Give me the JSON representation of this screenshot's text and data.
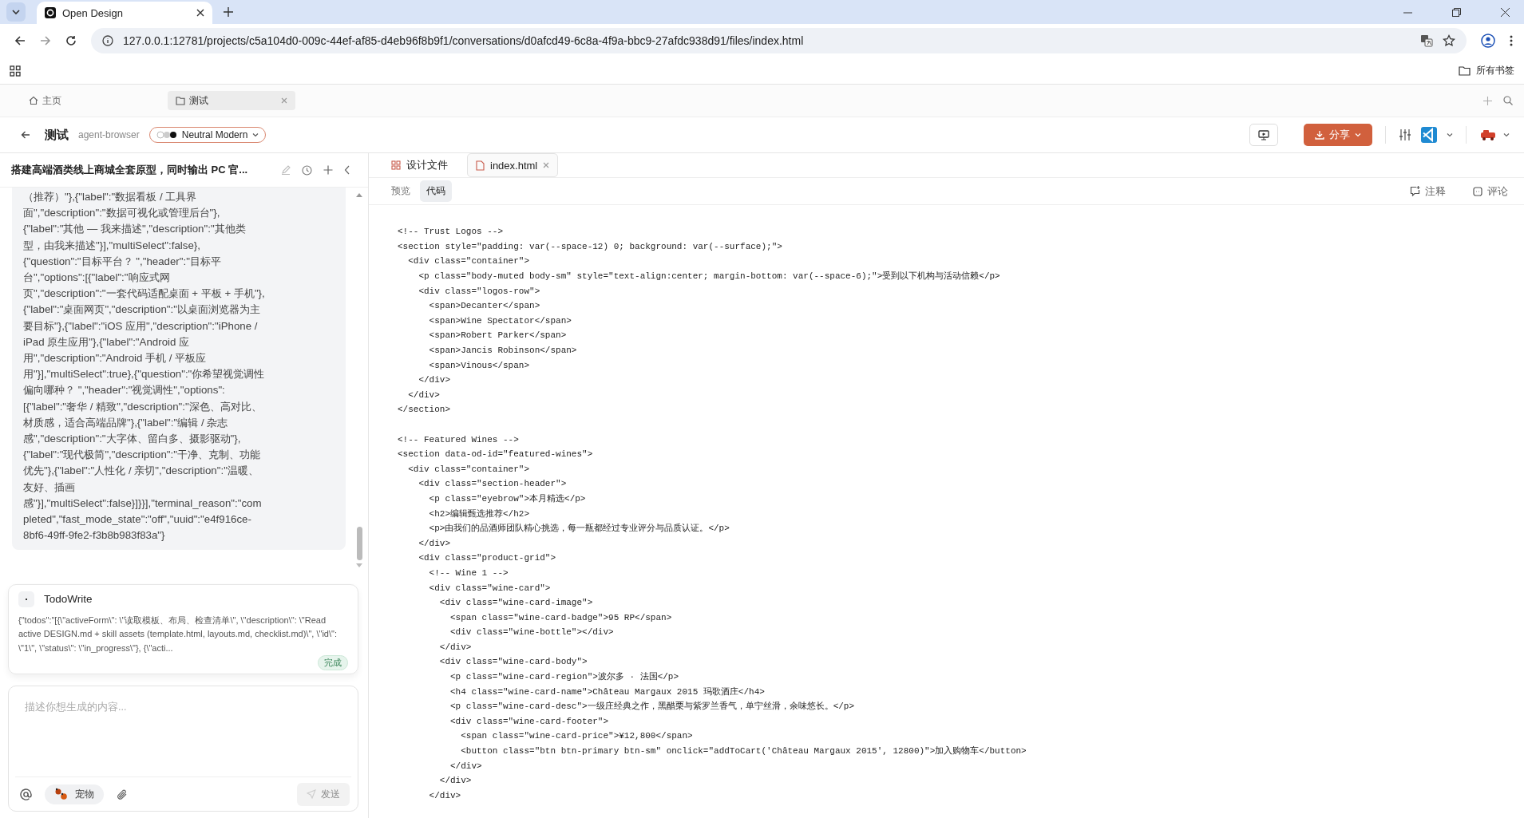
{
  "browser": {
    "tabs": [
      {
        "title": "Open Design",
        "selected": true
      }
    ],
    "url": "127.0.0.1:12781/projects/c5a104d0-009c-44ef-af85-d4eb96f8b9f1/conversations/d0afcd49-6c8a-4f9a-bbc9-27afdc938d91/files/index.html",
    "bookmarks_folder": "所有书签"
  },
  "app_tabs": [
    {
      "label": "主页",
      "kind": "home",
      "selected": false
    },
    {
      "label": "测试",
      "kind": "folder",
      "selected": true
    }
  ],
  "header": {
    "title": "测试",
    "agent": "agent-browser",
    "theme": "Neutral Modern",
    "share_label": "分享"
  },
  "chat": {
    "title": "搭建高端酒类线上商城全套原型，同时输出 PC 官...",
    "message_lines": [
      "（推荐）\"},{\"label\":\"数据看板 / 工具界",
      "面\",\"description\":\"数据可视化或管理后台\"},",
      "{\"label\":\"其他 — 我来描述\",\"description\":\"其他类",
      "型，由我来描述\"}],\"multiSelect\":false},",
      "{\"question\":\"目标平台？ \",\"header\":\"目标平",
      "台\",\"options\":[{\"label\":\"响应式网",
      "页\",\"description\":\"一套代码适配桌面 + 平板 + 手机\"},",
      "{\"label\":\"桌面网页\",\"description\":\"以桌面浏览器为主",
      "要目标\"},{\"label\":\"iOS 应用\",\"description\":\"iPhone /",
      "iPad 原生应用\"},{\"label\":\"Android 应",
      "用\",\"description\":\"Android 手机 / 平板应",
      "用\"}],\"multiSelect\":true},{\"question\":\"你希望视觉调性",
      "偏向哪种？ \",\"header\":\"视觉调性\",\"options\":",
      "[{\"label\":\"奢华 / 精致\",\"description\":\"深色、高对比、",
      "材质感，适合高端品牌\"},{\"label\":\"编辑 / 杂志",
      "感\",\"description\":\"大字体、留白多、摄影驱动\"},",
      "{\"label\":\"现代极简\",\"description\":\"干净、克制、功能",
      "优先\"},{\"label\":\"人性化 / 亲切\",\"description\":\"温暖、",
      "友好、插画",
      "感\"}],\"multiSelect\":false}]}}],\"terminal_reason\":\"com",
      "pleted\",\"fast_mode_state\":\"off\",\"uuid\":\"e4f916ce-",
      "8bf6-49ff-9fe2-f3b8b983f83a\"}"
    ],
    "tool_card": {
      "name": "TodoWrite",
      "body": "{\"todos\":\"[{\\\"activeForm\\\": \\\"读取模板、布局、检查清单\\\", \\\"description\\\": \\\"Read active DESIGN.md + skill assets (template.html, layouts.md, checklist.md)\\\", \\\"id\\\": \\\"1\\\", \\\"status\\\": \\\"in_progress\\\"}, {\\\"acti...",
      "status": "完成"
    },
    "composer": {
      "placeholder": "描述你想生成的内容...",
      "pet_label": "宠物",
      "send_label": "发送",
      "send_disabled": true
    }
  },
  "file_tabs": [
    {
      "label": "设计文件",
      "kind": "grid",
      "selected": false
    },
    {
      "label": "index.html",
      "kind": "file",
      "selected": true
    }
  ],
  "view_tabs": [
    {
      "label": "预览",
      "selected": false
    },
    {
      "label": "代码",
      "selected": true
    }
  ],
  "view_actions": [
    {
      "label": "注释",
      "kind": "annotate"
    },
    {
      "label": "评论",
      "kind": "comment"
    }
  ],
  "code_blocks": [
    [
      "<!-- Trust Logos -->",
      "<section style=\"padding: var(--space-12) 0; background: var(--surface);\">",
      "  <div class=\"container\">",
      "    <p class=\"body-muted body-sm\" style=\"text-align:center; margin-bottom: var(--space-6);\">受到以下机构与活动信赖</p>",
      "    <div class=\"logos-row\">",
      "      <span>Decanter</span>",
      "      <span>Wine Spectator</span>",
      "      <span>Robert Parker</span>",
      "      <span>Jancis Robinson</span>",
      "      <span>Vinous</span>",
      "    </div>",
      "  </div>",
      "</section>"
    ],
    [
      "<!-- Featured Wines -->",
      "<section data-od-id=\"featured-wines\">",
      "  <div class=\"container\">",
      "    <div class=\"section-header\">",
      "      <p class=\"eyebrow\">本月精选</p>",
      "      <h2>编辑甄选推荐</h2>",
      "      <p>由我们的品酒师团队精心挑选，每一瓶都经过专业评分与品质认证。</p>",
      "    </div>",
      "    <div class=\"product-grid\">",
      "      <!-- Wine 1 -->",
      "      <div class=\"wine-card\">",
      "        <div class=\"wine-card-image\">",
      "          <span class=\"wine-card-badge\">95 RP</span>",
      "          <div class=\"wine-bottle\"></div>",
      "        </div>",
      "        <div class=\"wine-card-body\">",
      "          <p class=\"wine-card-region\">波尔多 · 法国</p>",
      "          <h4 class=\"wine-card-name\">Château Margaux 2015 玛歌酒庄</h4>",
      "          <p class=\"wine-card-desc\">一级庄经典之作，黑醋栗与紫罗兰香气，单宁丝滑，余味悠长。</p>",
      "          <div class=\"wine-card-footer\">",
      "            <span class=\"wine-card-price\">¥12,800</span>",
      "            <button class=\"btn btn-primary btn-sm\" onclick=\"addToCart('Château Margaux 2015', 12800)\">加入购物车</button>",
      "          </div>",
      "        </div>",
      "      </div>"
    ]
  ]
}
